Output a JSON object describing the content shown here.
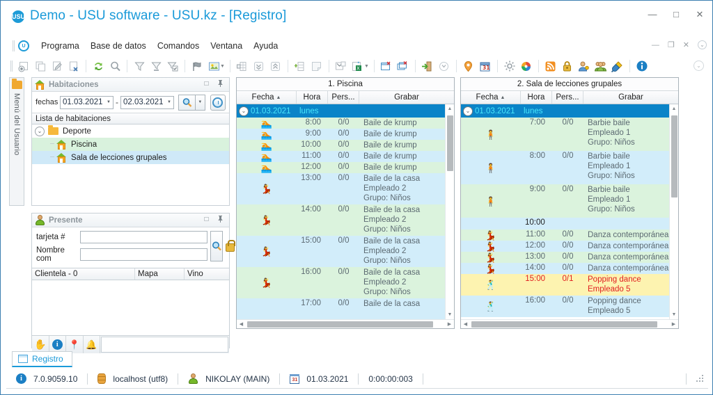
{
  "window": {
    "title": "Demo - USU software - USU.kz - [Registro]",
    "logo_text": "USU",
    "minimize": "—",
    "maximize": "□",
    "close": "✕"
  },
  "menu": {
    "items": [
      "Programa",
      "Base de datos",
      "Comandos",
      "Ventana",
      "Ayuda"
    ],
    "mdi_minimize": "—",
    "mdi_restore": "❐",
    "mdi_close": "✕",
    "mdi_more": "⌄"
  },
  "toolbar": {
    "icons": [
      "add-record-icon",
      "copy-record-icon",
      "edit-record-icon",
      "delete-record-icon",
      "refresh-icon",
      "search-icon",
      "filter-icon",
      "filter-remove-icon",
      "filter-apply-icon",
      "flag-icon",
      "image-icon",
      "group-columns-icon",
      "expand-all-icon",
      "collapse-all-icon",
      "insert-row-icon",
      "note-icon",
      "export-icon",
      "excel-export-icon",
      "new-window-icon",
      "new-windows-icon",
      "exit-icon",
      "more-icon",
      "marker-icon",
      "calendar-icon",
      "settings-icon",
      "palette-icon",
      "rss-icon",
      "lock-icon",
      "user-key-icon",
      "users-icon",
      "plug-icon",
      "about-icon"
    ],
    "overflow": "⌄"
  },
  "sidebar": {
    "vertical_tab_label": "Menú del Usuario",
    "vertical_tab_icon": "folder-icon"
  },
  "habitaciones": {
    "title": "Habitaciones",
    "icon": "house-icon",
    "restore_btn": "□",
    "pin_btn": "📌",
    "filter_label": "fechas",
    "date_from": "01.03.2021",
    "date_to": "02.03.2021",
    "dash": "-",
    "search_icon": "magnifier-icon",
    "dropdown_caret": "▾",
    "clock_icon": "clock-icon",
    "list_header": "Lista de habitaciones",
    "tree": [
      {
        "label": "Deporte",
        "level": 0,
        "icon": "folder-icon",
        "expander": "⌄",
        "bg": "none"
      },
      {
        "label": "Piscina",
        "level": 1,
        "icon": "house-icon",
        "bg": "green"
      },
      {
        "label": "Sala de lecciones grupales",
        "level": 1,
        "icon": "house-icon",
        "bg": "blue"
      }
    ]
  },
  "presente": {
    "title": "Presente",
    "icon": "user-icon",
    "restore_btn": "□",
    "pin_btn": "📌",
    "field_card_label": "tarjeta #",
    "field_card_value": "",
    "field_name_label": "Nombre com",
    "field_name_value": "",
    "search_icon": "magnifier-icon",
    "lock_icon": "lock-icon",
    "columns": [
      "Clientela - 0",
      "Mapa",
      "Vino"
    ],
    "rows": [],
    "toolbar_icons": [
      "hand-icon",
      "info-icon",
      "pin-icon",
      "bell-icon"
    ],
    "toolbar_input_value": ""
  },
  "schedules": [
    {
      "title": "1. Piscina",
      "columns": [
        "Fecha",
        "Hora",
        "Pers...",
        "Grabar"
      ],
      "sort_arrow": "▲",
      "date_group": {
        "date": "01.03.2021",
        "weekday": "lunes",
        "expander": "⌄"
      },
      "entries": [
        {
          "icon": "swimmer-icon",
          "hora": "8:00",
          "pers": "0/0",
          "text": "Baile de krump",
          "bg": "green"
        },
        {
          "icon": "swimmer-icon",
          "hora": "9:00",
          "pers": "0/0",
          "text": "Baile de krump",
          "bg": "blue"
        },
        {
          "icon": "swimmer-icon",
          "hora": "10:00",
          "pers": "0/0",
          "text": "Baile de krump",
          "bg": "green"
        },
        {
          "icon": "swimmer-icon",
          "hora": "11:00",
          "pers": "0/0",
          "text": "Baile de krump",
          "bg": "blue"
        },
        {
          "icon": "swimmer-icon",
          "hora": "12:00",
          "pers": "0/0",
          "text": "Baile de krump",
          "bg": "green"
        },
        {
          "icon": "dancer-icon",
          "hora": "13:00",
          "pers": "0/0",
          "text": "Baile de la casa\nEmpleado 2\nGrupo: Niños",
          "bg": "blue"
        },
        {
          "icon": "dancer-icon",
          "hora": "14:00",
          "pers": "0/0",
          "text": "Baile de la casa\nEmpleado 2\nGrupo: Niños",
          "bg": "green"
        },
        {
          "icon": "dancer-icon",
          "hora": "15:00",
          "pers": "0/0",
          "text": "Baile de la casa\nEmpleado 2\nGrupo: Niños",
          "bg": "blue"
        },
        {
          "icon": "dancer-icon",
          "hora": "16:00",
          "pers": "0/0",
          "text": "Baile de la casa\nEmpleado 2\nGrupo: Niños",
          "bg": "green"
        },
        {
          "icon": "dancer-icon",
          "hora": "17:00",
          "pers": "0/0",
          "text": "Baile de la casa",
          "bg": "blue"
        }
      ]
    },
    {
      "title": "2. Sala de lecciones grupales",
      "columns": [
        "Fecha",
        "Hora",
        "Pers...",
        "Grabar"
      ],
      "sort_arrow": "▲",
      "date_group": {
        "date": "01.03.2021",
        "weekday": "lunes",
        "expander": "⌄"
      },
      "entries": [
        {
          "icon": "girl-icon",
          "hora": "7:00",
          "pers": "0/0",
          "text": "Barbie baile\nEmpleado 1\nGrupo: Niños",
          "bg": "green"
        },
        {
          "icon": "girl-icon",
          "hora": "8:00",
          "pers": "0/0",
          "text": "Barbie baile\nEmpleado 1\nGrupo: Niños",
          "bg": "blue"
        },
        {
          "icon": "girl-icon",
          "hora": "9:00",
          "pers": "0/0",
          "text": "Barbie baile\nEmpleado 1\nGrupo: Niños",
          "bg": "green"
        },
        {
          "icon": "",
          "hora": "10:00",
          "pers": "",
          "text": "",
          "bg": "blue",
          "timeonly": true
        },
        {
          "icon": "couple-icon",
          "hora": "11:00",
          "pers": "0/0",
          "text": "Danza contemporánea",
          "bg": "green"
        },
        {
          "icon": "couple-icon",
          "hora": "12:00",
          "pers": "0/0",
          "text": "Danza contemporánea",
          "bg": "blue"
        },
        {
          "icon": "couple-icon",
          "hora": "13:00",
          "pers": "0/0",
          "text": "Danza contemporánea",
          "bg": "green"
        },
        {
          "icon": "couple-icon",
          "hora": "14:00",
          "pers": "0/0",
          "text": "Danza contemporánea",
          "bg": "blue"
        },
        {
          "icon": "popping-icon",
          "hora": "15:00",
          "pers": "0/1",
          "text": "Popping dance\nEmpleado 5",
          "bg": "hl"
        },
        {
          "icon": "popping-icon",
          "hora": "16:00",
          "pers": "0/0",
          "text": "Popping dance\nEmpleado 5",
          "bg": "blue"
        }
      ]
    }
  ],
  "tabs": {
    "active": "Registro",
    "icon": "window-icon"
  },
  "statusbar": {
    "version": "7.0.9059.10",
    "version_icon": "info-icon",
    "server": "localhost (utf8)",
    "server_icon": "database-icon",
    "user": "NIKOLAY (MAIN)",
    "user_icon": "user-icon",
    "date": "01.03.2021",
    "date_icon": "calendar-icon",
    "elapsed": "0:00:00:003",
    "grip": "resize-grip-icon"
  },
  "colors": {
    "accent": "#1a9ad9",
    "selection": "#0a84c8",
    "selection_text": "#49e7fb",
    "row_green": "#dbf3dd",
    "row_blue": "#d2edfa",
    "row_highlight_bg": "#fdf3b0",
    "row_highlight_text": "#e02020"
  }
}
